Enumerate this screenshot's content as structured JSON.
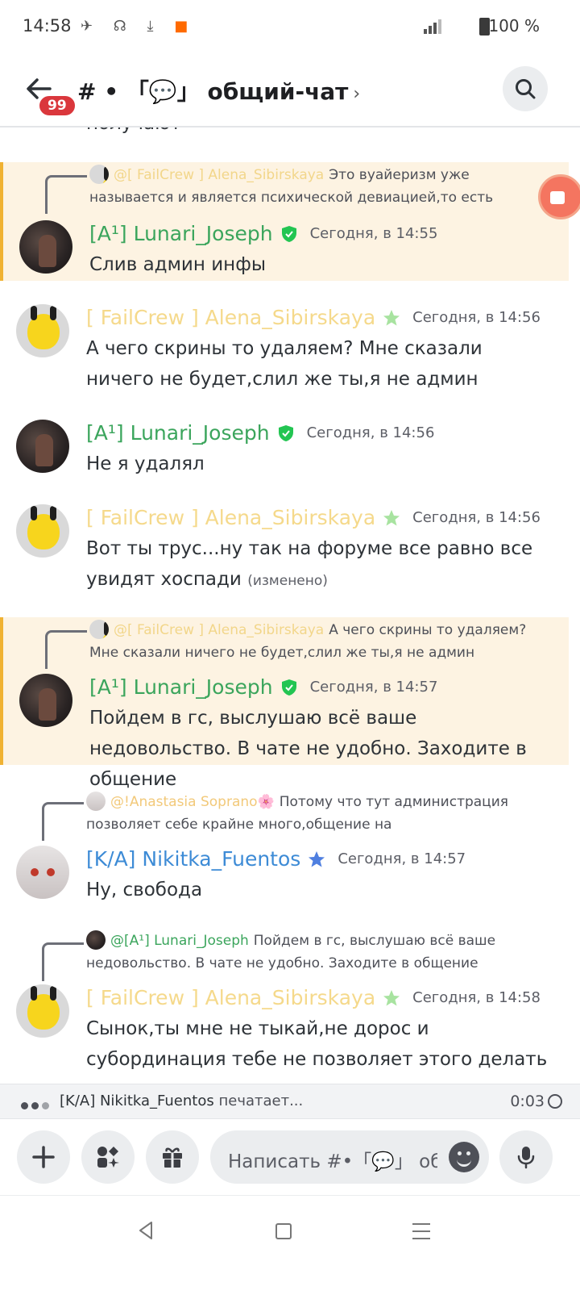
{
  "status_bar": {
    "time": "14:58",
    "battery": "100 %",
    "network": "3G"
  },
  "header": {
    "badge": "99",
    "channel_title": "# • 「💬」 общий-чат",
    "chevron": "›"
  },
  "messages": [
    {
      "cut_text": "получают"
    },
    {
      "highlighted": true,
      "reply": {
        "name": "@[ FailCrew ] Alena_Sibirskaya",
        "text": "Это вуайеризм уже называется и является психической девиацией,то есть"
      },
      "author": "[A¹] Lunari_Joseph",
      "time": "Сегодня, в 14:55",
      "text": "Слив админ инфы"
    },
    {
      "author": "[ FailCrew ] Alena_Sibirskaya",
      "time": "Сегодня, в 14:56",
      "text": "А чего скрины то удаляем? Мне сказали ничего не будет,слил же ты,я не админ"
    },
    {
      "author": "[A¹] Lunari_Joseph",
      "time": "Сегодня, в 14:56",
      "text": "Не я удалял"
    },
    {
      "author": "[ FailCrew ] Alena_Sibirskaya",
      "time": "Сегодня, в 14:56",
      "text": "Вот ты трус...ну так на форуме все равно все увидят хоспади",
      "edited": "(изменено)"
    },
    {
      "highlighted": true,
      "reply": {
        "name": "@[ FailCrew ] Alena_Sibirskaya",
        "text": "А чего скрины то удаляем? Мне сказали ничего не будет,слил же ты,я не админ"
      },
      "author": "[A¹] Lunari_Joseph",
      "time": "Сегодня, в 14:57",
      "text": "Пойдем в гс, выслушаю всё ваше недовольство. В чате не удобно. Заходите в общение"
    },
    {
      "reply": {
        "name": "@!Anastasia Soprano🌸",
        "text": "Потому что тут администрация позволяет себе крайне много,общение на"
      },
      "author": "[K/A] Nikitka_Fuentos",
      "time": "Сегодня, в 14:57",
      "text": "Ну, свобода"
    },
    {
      "reply": {
        "name": "@[A¹] Lunari_Joseph",
        "text": "Пойдем в гс, выслушаю всё ваше недовольство. В чате не удобно. Заходите в общение"
      },
      "author": "[ FailCrew ] Alena_Sibirskaya",
      "time": "Сегодня, в 14:58",
      "text": "Сынок,ты мне не тыкай,не дорос и субординация тебе не позволяет этого делать"
    }
  ],
  "typing": {
    "user": "[K/A] Nikitka_Fuentos",
    "suffix": "печатает...",
    "timer": "0:03"
  },
  "composer": {
    "placeholder": "Написать #•「💬」 общий-чат"
  },
  "colors": {
    "highlight_bg": "#fdf3e2",
    "highlight_border": "#f0b232",
    "green_name": "#3ba55c",
    "yellow_name": "#f5d98b",
    "blue_name": "#3d8bd6",
    "badge": "#da373c"
  },
  "icons": [
    "back-arrow-icon",
    "search-icon",
    "plus-icon",
    "apps-icon",
    "gift-icon",
    "emoji-icon",
    "microphone-icon",
    "shield-role-icon",
    "star-role-icon",
    "timer-icon"
  ]
}
